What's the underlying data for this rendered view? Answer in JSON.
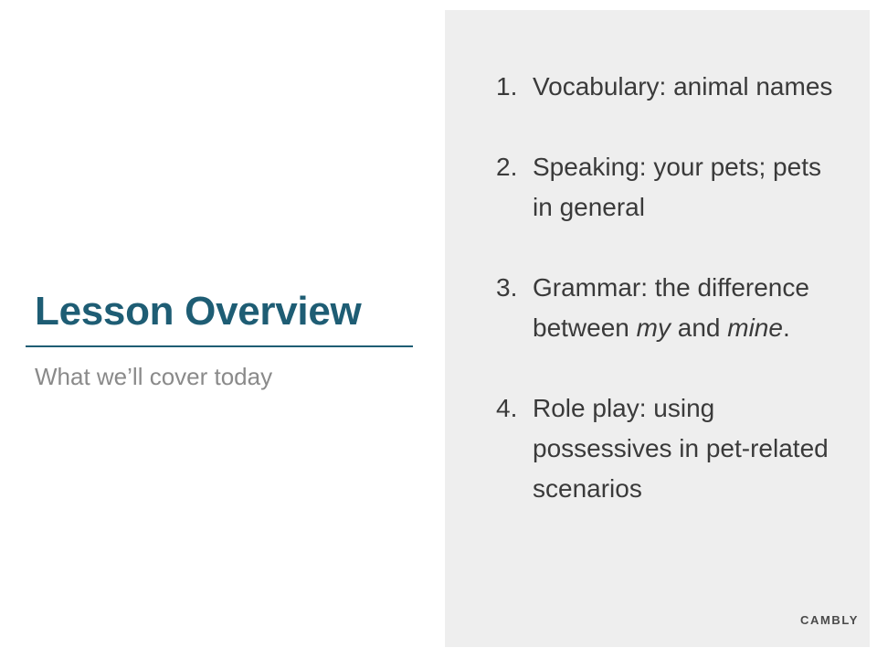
{
  "slide": {
    "title": "Lesson Overview",
    "subtitle": "What we’ll cover today"
  },
  "agenda": [
    {
      "number": "1.",
      "text": "Vocabulary: animal names"
    },
    {
      "number": "2.",
      "text": "Speaking: your pets; pets in general"
    },
    {
      "number": "3.",
      "text_before": "Grammar: the difference between ",
      "em1": "my",
      "text_middle": " and ",
      "em2": "mine",
      "text_after": "."
    },
    {
      "number": "4.",
      "text": "Role play: using possessives in pet-related scenarios"
    }
  ],
  "brand": "CAMBLY",
  "colors": {
    "title": "#1e5d74",
    "panel": "#eeeeee",
    "subtitle": "#8a8a8a",
    "body_text": "#3a3a3a"
  }
}
